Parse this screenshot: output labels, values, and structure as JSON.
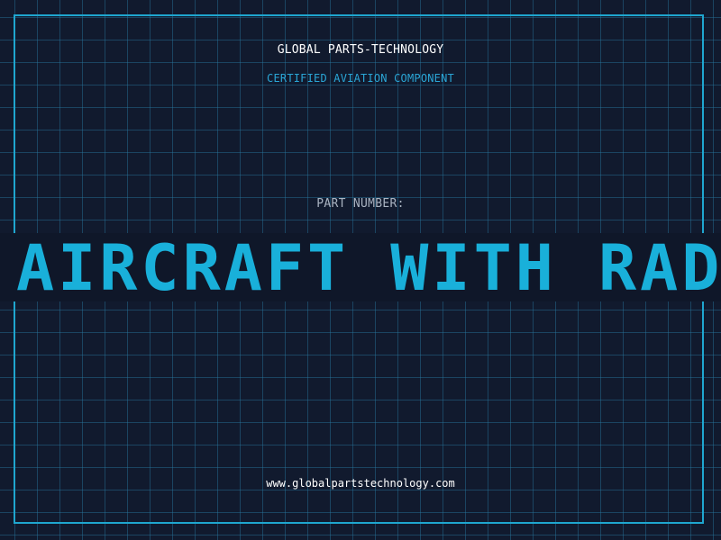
{
  "header": {
    "company": "GLOBAL PARTS-TECHNOLOGY",
    "subtitle": "CERTIFIED AVIATION COMPONENT"
  },
  "part": {
    "label": "PART NUMBER:",
    "value": "AIRCRAFT WITH RADA"
  },
  "footer": {
    "url": "www.globalpartstechnology.com"
  },
  "colors": {
    "background": "#111a2e",
    "grid": "#28789f",
    "frame": "#1fa6cf",
    "accent": "#19b0da",
    "label": "#aab4c2"
  }
}
